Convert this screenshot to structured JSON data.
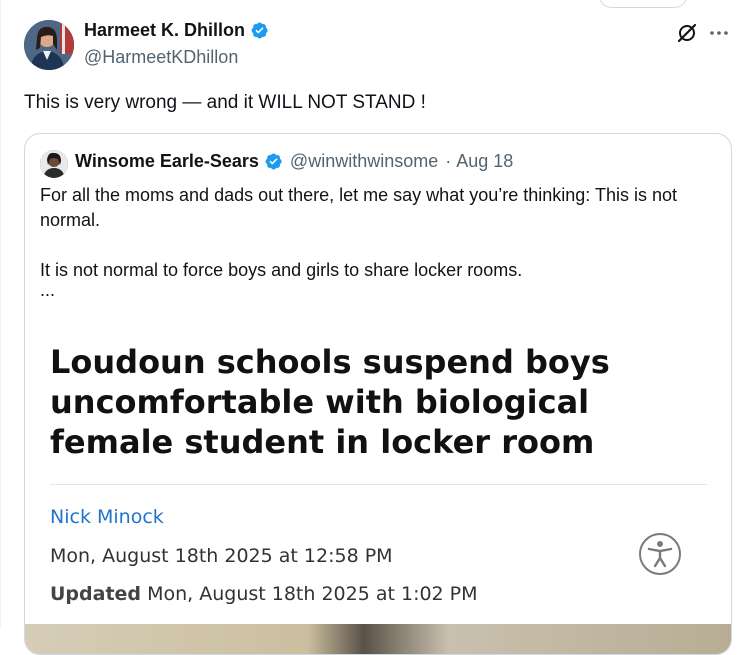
{
  "post": {
    "author_name": "Harmeet K. Dhillon",
    "handle": "@HarmeetKDhillon",
    "text": "This is very wrong — and it WILL NOT STAND !",
    "icons": [
      "verified-badge-icon",
      "grok-icon",
      "more-icon"
    ]
  },
  "quote": {
    "author_name": "Winsome Earle-Sears",
    "handle": "@winwithwinsome",
    "separator": "·",
    "date": "Aug 18",
    "text_line1": "For all the moms and dads out there, let me say what you’re thinking: This is not normal.",
    "text_line2": "It is not normal to force boys and girls to share locker rooms.",
    "ellipsis": "...",
    "article": {
      "headline": "Loudoun schools suspend boys uncomfortable with biological female student in locker room",
      "author": "Nick Minock",
      "published": "Mon, August 18th 2025 at 12:58 PM",
      "updated_label": "Updated",
      "updated": "Mon, August 18th 2025 at 1:02 PM",
      "icons": [
        "accessibility-icon"
      ]
    }
  },
  "colors": {
    "verified": "#1d9bf0",
    "link_blue": "#2274c9",
    "secondary_text": "#536471"
  }
}
